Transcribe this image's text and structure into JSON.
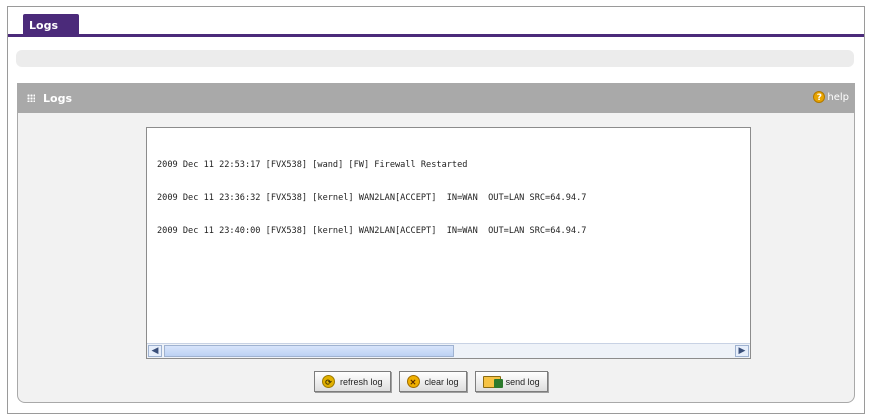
{
  "tabs": [
    {
      "label": "Logs"
    }
  ],
  "section": {
    "title": "Logs",
    "help_label": "help"
  },
  "logs": {
    "lines": [
      "2009 Dec 11 22:53:17 [FVX538] [wand] [FW] Firewall Restarted",
      "2009 Dec 11 23:36:32 [FVX538] [kernel] WAN2LAN[ACCEPT]  IN=WAN  OUT=LAN SRC=64.94.7",
      "2009 Dec 11 23:40:00 [FVX538] [kernel] WAN2LAN[ACCEPT]  IN=WAN  OUT=LAN SRC=64.94.7"
    ]
  },
  "buttons": {
    "refresh": "refresh log",
    "clear": "clear log",
    "send": "send log"
  },
  "colors": {
    "tab_purple": "#4b2a7a",
    "header_gray": "#a9a9a9",
    "help_orange": "#e8a400"
  },
  "icons": {
    "help": "help-icon",
    "refresh": "refresh-icon",
    "clear": "clear-icon",
    "send": "send-icon"
  }
}
